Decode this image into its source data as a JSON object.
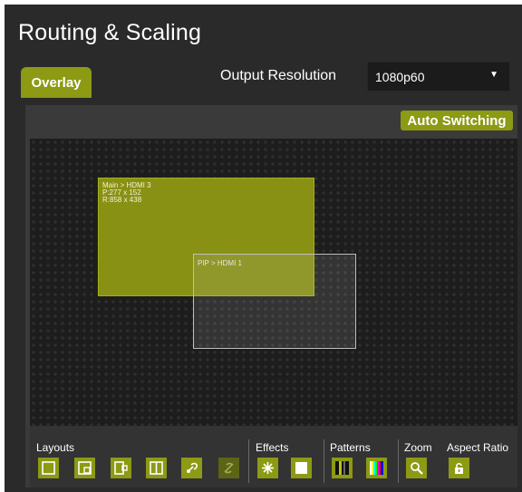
{
  "header": {
    "title": "Routing & Scaling"
  },
  "tabs": [
    {
      "label": "Overlay",
      "active": true
    }
  ],
  "output": {
    "label": "Output Resolution",
    "value": "1080p60"
  },
  "auto_switching": {
    "label": "Auto Switching"
  },
  "canvas": {
    "main": {
      "label": "Main > HDMI 3",
      "pos": "P:277 x 152",
      "res": "R:858 x 438"
    },
    "pip": {
      "label": "PIP > HDMI 1"
    }
  },
  "toolbar": {
    "layouts": {
      "label": "Layouts",
      "buttons": [
        {
          "name": "layout-single-icon"
        },
        {
          "name": "layout-pip-corner-icon"
        },
        {
          "name": "layout-pip-side-icon"
        },
        {
          "name": "layout-split-icon"
        },
        {
          "name": "swap-icon"
        },
        {
          "name": "unlink-icon"
        }
      ]
    },
    "effects": {
      "label": "Effects",
      "buttons": [
        {
          "name": "sparkle-icon"
        },
        {
          "name": "blank-screen-icon"
        }
      ]
    },
    "patterns": {
      "label": "Patterns",
      "buttons": [
        {
          "name": "bars-pattern-icon"
        },
        {
          "name": "color-bars-icon"
        }
      ]
    },
    "zoom": {
      "label": "Zoom",
      "buttons": [
        {
          "name": "magnify-icon"
        }
      ]
    },
    "aspect": {
      "label": "Aspect Ratio",
      "buttons": [
        {
          "name": "lock-icon"
        }
      ]
    }
  },
  "colors": {
    "accent": "#8c9a14",
    "background": "#2a2a2a",
    "canvas": "#1d1d1d"
  }
}
